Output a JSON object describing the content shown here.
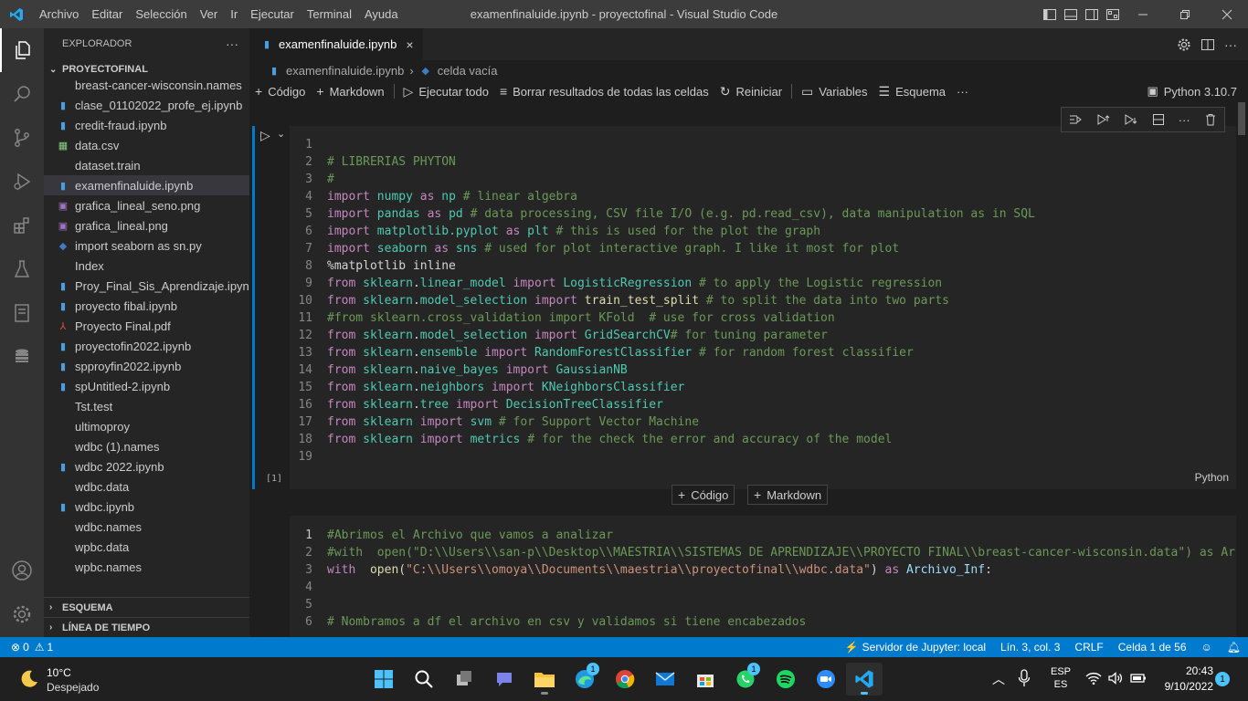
{
  "titlebar": {
    "menu": [
      "Archivo",
      "Editar",
      "Selección",
      "Ver",
      "Ir",
      "Ejecutar",
      "Terminal",
      "Ayuda"
    ],
    "window_title": "examenfinaluide.ipynb - proyectofinal - Visual Studio Code"
  },
  "sidebar": {
    "header": "EXPLORADOR",
    "more": "···",
    "folder": "PROYECTOFINAL",
    "files": [
      {
        "name": "breast-cancer-wisconsin.names",
        "icon": "none"
      },
      {
        "name": "clase_01102022_profe_ej.ipynb",
        "icon": "notebook"
      },
      {
        "name": "credit-fraud.ipynb",
        "icon": "notebook"
      },
      {
        "name": "data.csv",
        "icon": "csv"
      },
      {
        "name": "dataset.train",
        "icon": "none"
      },
      {
        "name": "examenfinaluide.ipynb",
        "icon": "notebook"
      },
      {
        "name": "grafica_lineal_seno.png",
        "icon": "image"
      },
      {
        "name": "grafica_lineal.png",
        "icon": "image"
      },
      {
        "name": "import seaborn as sn.py",
        "icon": "python"
      },
      {
        "name": "Index",
        "icon": "none"
      },
      {
        "name": "Proy_Final_Sis_Aprendizaje.ipynb",
        "icon": "notebook"
      },
      {
        "name": "proyecto fibal.ipynb",
        "icon": "notebook"
      },
      {
        "name": "Proyecto Final.pdf",
        "icon": "pdf"
      },
      {
        "name": "proyectofin2022.ipynb",
        "icon": "notebook"
      },
      {
        "name": "spproyfin2022.ipynb",
        "icon": "notebook"
      },
      {
        "name": "spUntitled-2.ipynb",
        "icon": "notebook"
      },
      {
        "name": "Tst.test",
        "icon": "none"
      },
      {
        "name": "ultimoproy",
        "icon": "none"
      },
      {
        "name": "wdbc (1).names",
        "icon": "none"
      },
      {
        "name": "wdbc 2022.ipynb",
        "icon": "notebook"
      },
      {
        "name": "wdbc.data",
        "icon": "none"
      },
      {
        "name": "wdbc.ipynb",
        "icon": "notebook"
      },
      {
        "name": "wdbc.names",
        "icon": "none"
      },
      {
        "name": "wpbc.data",
        "icon": "none"
      },
      {
        "name": "wpbc.names",
        "icon": "none"
      }
    ],
    "outline": "ESQUEMA",
    "timeline": "LÍNEA DE TIEMPO"
  },
  "editor": {
    "tab": "examenfinaluide.ipynb",
    "close": "×",
    "breadcrumb": {
      "file": "examenfinaluide.ipynb",
      "sep": "›",
      "cell": "celda vacía"
    },
    "toolbar": {
      "code": "Código",
      "markdown": "Markdown",
      "run_all": "Ejecutar todo",
      "clear_all": "Borrar resultados de todas las celdas",
      "restart": "Reiniciar",
      "variables": "Variables",
      "outline": "Esquema",
      "more": "···",
      "kernel": "Python 3.10.7"
    },
    "cell1": {
      "exec_count": "[1]",
      "language": "Python",
      "lines": [
        {
          "n": "1",
          "t": []
        },
        {
          "n": "2",
          "t": [
            {
              "c": "cm",
              "s": "# LIBRERIAS PHYTON"
            }
          ]
        },
        {
          "n": "3",
          "t": [
            {
              "c": "cm",
              "s": "#"
            }
          ]
        },
        {
          "n": "4",
          "t": [
            {
              "c": "kw",
              "s": "import"
            },
            {
              "c": "tx",
              "s": " "
            },
            {
              "c": "mod",
              "s": "numpy"
            },
            {
              "c": "tx",
              "s": " "
            },
            {
              "c": "kw",
              "s": "as"
            },
            {
              "c": "tx",
              "s": " "
            },
            {
              "c": "mod",
              "s": "np"
            },
            {
              "c": "tx",
              "s": " "
            },
            {
              "c": "cm",
              "s": "# linear algebra"
            }
          ]
        },
        {
          "n": "5",
          "t": [
            {
              "c": "kw",
              "s": "import"
            },
            {
              "c": "tx",
              "s": " "
            },
            {
              "c": "mod",
              "s": "pandas"
            },
            {
              "c": "tx",
              "s": " "
            },
            {
              "c": "kw",
              "s": "as"
            },
            {
              "c": "tx",
              "s": " "
            },
            {
              "c": "mod",
              "s": "pd"
            },
            {
              "c": "tx",
              "s": " "
            },
            {
              "c": "cm",
              "s": "# data processing, CSV file I/O (e.g. pd.read_csv), data manipulation as in SQL"
            }
          ]
        },
        {
          "n": "6",
          "t": [
            {
              "c": "kw",
              "s": "import"
            },
            {
              "c": "tx",
              "s": " "
            },
            {
              "c": "mod",
              "s": "matplotlib.pyplot"
            },
            {
              "c": "tx",
              "s": " "
            },
            {
              "c": "kw",
              "s": "as"
            },
            {
              "c": "tx",
              "s": " "
            },
            {
              "c": "mod",
              "s": "plt"
            },
            {
              "c": "tx",
              "s": " "
            },
            {
              "c": "cm",
              "s": "# this is used for the plot the graph"
            }
          ]
        },
        {
          "n": "7",
          "t": [
            {
              "c": "kw",
              "s": "import"
            },
            {
              "c": "tx",
              "s": " "
            },
            {
              "c": "mod",
              "s": "seaborn"
            },
            {
              "c": "tx",
              "s": " "
            },
            {
              "c": "kw",
              "s": "as"
            },
            {
              "c": "tx",
              "s": " "
            },
            {
              "c": "mod",
              "s": "sns"
            },
            {
              "c": "tx",
              "s": " "
            },
            {
              "c": "cm",
              "s": "# used for plot interactive graph. I like it most for plot"
            }
          ]
        },
        {
          "n": "8",
          "t": [
            {
              "c": "mag",
              "s": "%matplotlib inline"
            }
          ]
        },
        {
          "n": "9",
          "t": [
            {
              "c": "kw",
              "s": "from"
            },
            {
              "c": "tx",
              "s": " "
            },
            {
              "c": "mod",
              "s": "sklearn"
            },
            {
              "c": "tx",
              "s": "."
            },
            {
              "c": "mod",
              "s": "linear_model"
            },
            {
              "c": "tx",
              "s": " "
            },
            {
              "c": "kw",
              "s": "import"
            },
            {
              "c": "tx",
              "s": " "
            },
            {
              "c": "cls",
              "s": "LogisticRegression"
            },
            {
              "c": "tx",
              "s": " "
            },
            {
              "c": "cm",
              "s": "# to apply the Logistic regression"
            }
          ]
        },
        {
          "n": "10",
          "t": [
            {
              "c": "kw",
              "s": "from"
            },
            {
              "c": "tx",
              "s": " "
            },
            {
              "c": "mod",
              "s": "sklearn"
            },
            {
              "c": "tx",
              "s": "."
            },
            {
              "c": "mod",
              "s": "model_selection"
            },
            {
              "c": "tx",
              "s": " "
            },
            {
              "c": "kw",
              "s": "import"
            },
            {
              "c": "tx",
              "s": " "
            },
            {
              "c": "fn",
              "s": "train_test_split"
            },
            {
              "c": "tx",
              "s": " "
            },
            {
              "c": "cm",
              "s": "# to split the data into two parts"
            }
          ]
        },
        {
          "n": "11",
          "t": [
            {
              "c": "cm",
              "s": "#from sklearn.cross_validation import KFold  # use for cross validation"
            }
          ]
        },
        {
          "n": "12",
          "t": [
            {
              "c": "kw",
              "s": "from"
            },
            {
              "c": "tx",
              "s": " "
            },
            {
              "c": "mod",
              "s": "sklearn"
            },
            {
              "c": "tx",
              "s": "."
            },
            {
              "c": "mod",
              "s": "model_selection"
            },
            {
              "c": "tx",
              "s": " "
            },
            {
              "c": "kw",
              "s": "import"
            },
            {
              "c": "tx",
              "s": " "
            },
            {
              "c": "cls",
              "s": "GridSearchCV"
            },
            {
              "c": "cm",
              "s": "# for tuning parameter"
            }
          ]
        },
        {
          "n": "13",
          "t": [
            {
              "c": "kw",
              "s": "from"
            },
            {
              "c": "tx",
              "s": " "
            },
            {
              "c": "mod",
              "s": "sklearn"
            },
            {
              "c": "tx",
              "s": "."
            },
            {
              "c": "mod",
              "s": "ensemble"
            },
            {
              "c": "tx",
              "s": " "
            },
            {
              "c": "kw",
              "s": "import"
            },
            {
              "c": "tx",
              "s": " "
            },
            {
              "c": "cls",
              "s": "RandomForestClassifier"
            },
            {
              "c": "tx",
              "s": " "
            },
            {
              "c": "cm",
              "s": "# for random forest classifier"
            }
          ]
        },
        {
          "n": "14",
          "t": [
            {
              "c": "kw",
              "s": "from"
            },
            {
              "c": "tx",
              "s": " "
            },
            {
              "c": "mod",
              "s": "sklearn"
            },
            {
              "c": "tx",
              "s": "."
            },
            {
              "c": "mod",
              "s": "naive_bayes"
            },
            {
              "c": "tx",
              "s": " "
            },
            {
              "c": "kw",
              "s": "import"
            },
            {
              "c": "tx",
              "s": " "
            },
            {
              "c": "cls",
              "s": "GaussianNB"
            }
          ]
        },
        {
          "n": "15",
          "t": [
            {
              "c": "kw",
              "s": "from"
            },
            {
              "c": "tx",
              "s": " "
            },
            {
              "c": "mod",
              "s": "sklearn"
            },
            {
              "c": "tx",
              "s": "."
            },
            {
              "c": "mod",
              "s": "neighbors"
            },
            {
              "c": "tx",
              "s": " "
            },
            {
              "c": "kw",
              "s": "import"
            },
            {
              "c": "tx",
              "s": " "
            },
            {
              "c": "cls",
              "s": "KNeighborsClassifier"
            }
          ]
        },
        {
          "n": "16",
          "t": [
            {
              "c": "kw",
              "s": "from"
            },
            {
              "c": "tx",
              "s": " "
            },
            {
              "c": "mod",
              "s": "sklearn"
            },
            {
              "c": "tx",
              "s": "."
            },
            {
              "c": "mod",
              "s": "tree"
            },
            {
              "c": "tx",
              "s": " "
            },
            {
              "c": "kw",
              "s": "import"
            },
            {
              "c": "tx",
              "s": " "
            },
            {
              "c": "cls",
              "s": "DecisionTreeClassifier"
            }
          ]
        },
        {
          "n": "17",
          "t": [
            {
              "c": "kw",
              "s": "from"
            },
            {
              "c": "tx",
              "s": " "
            },
            {
              "c": "mod",
              "s": "sklearn"
            },
            {
              "c": "tx",
              "s": " "
            },
            {
              "c": "kw",
              "s": "import"
            },
            {
              "c": "tx",
              "s": " "
            },
            {
              "c": "mod",
              "s": "svm"
            },
            {
              "c": "tx",
              "s": " "
            },
            {
              "c": "cm",
              "s": "# for Support Vector Machine"
            }
          ]
        },
        {
          "n": "18",
          "t": [
            {
              "c": "kw",
              "s": "from"
            },
            {
              "c": "tx",
              "s": " "
            },
            {
              "c": "mod",
              "s": "sklearn"
            },
            {
              "c": "tx",
              "s": " "
            },
            {
              "c": "kw",
              "s": "import"
            },
            {
              "c": "tx",
              "s": " "
            },
            {
              "c": "mod",
              "s": "metrics"
            },
            {
              "c": "tx",
              "s": " "
            },
            {
              "c": "cm",
              "s": "# for the check the error and accuracy of the model"
            }
          ]
        },
        {
          "n": "19",
          "t": []
        }
      ]
    },
    "add_code": "Código",
    "add_markdown": "Markdown",
    "cell2": {
      "lines": [
        {
          "n": "1",
          "t": [
            {
              "c": "cm",
              "s": "#Abrimos el Archivo que vamos a analizar"
            }
          ]
        },
        {
          "n": "2",
          "t": [
            {
              "c": "cm",
              "s": "#with  open(\"D:\\\\Users\\\\san-p\\\\Desktop\\\\MAESTRIA\\\\SISTEMAS DE APRENDIZAJE\\\\PROYECTO FINAL\\\\breast-cancer-wisconsin.data\") as Ar"
            }
          ]
        },
        {
          "n": "3",
          "t": [
            {
              "c": "kw",
              "s": "with"
            },
            {
              "c": "tx",
              "s": "  "
            },
            {
              "c": "fn",
              "s": "open"
            },
            {
              "c": "tx",
              "s": "("
            },
            {
              "c": "str",
              "s": "\"C:\\\\Users\\\\omoya\\\\Documents\\\\maestria\\\\proyectofinal\\\\wdbc.data\""
            },
            {
              "c": "tx",
              "s": ") "
            },
            {
              "c": "kw",
              "s": "as"
            },
            {
              "c": "tx",
              "s": " "
            },
            {
              "c": "var",
              "s": "Archivo_Inf"
            },
            {
              "c": "tx",
              "s": ":"
            }
          ]
        },
        {
          "n": "4",
          "t": []
        },
        {
          "n": "5",
          "t": []
        },
        {
          "n": "6",
          "t": [
            {
              "c": "cm",
              "s": "# Nombramos a df el archivo en csv y validamos si tiene encabezados"
            }
          ]
        }
      ]
    }
  },
  "statusbar": {
    "errors": "0",
    "warnings": "1",
    "jupyter": "Servidor de Jupyter: local",
    "position": "Lín. 3, col. 3",
    "eol": "CRLF",
    "cell": "Celda 1 de 56"
  },
  "taskbar": {
    "temp": "10°C",
    "weather": "Despejado",
    "lang": "ESP",
    "region": "ES",
    "time": "20:43",
    "date": "9/10/2022",
    "notif": "1",
    "edge_badge": "1"
  },
  "colors": {
    "accent": "#007acc",
    "python_icon": "#3e7bbf",
    "notebook_icon": "#4a9de0",
    "csv_icon": "#89d185",
    "pdf_icon": "#e5463c"
  }
}
